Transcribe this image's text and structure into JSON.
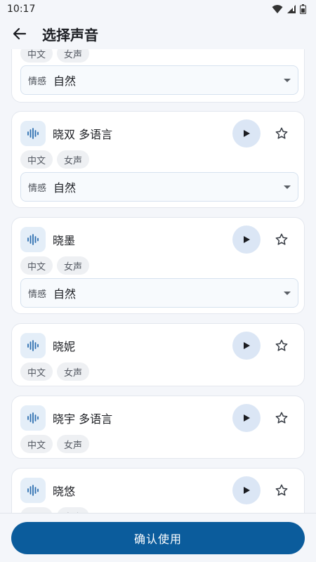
{
  "status_bar": {
    "time": "10:17",
    "icons": [
      "wifi-icon",
      "signal-icon",
      "battery-icon"
    ]
  },
  "header": {
    "title": "选择声音",
    "back_icon": "arrow-left-icon"
  },
  "voices": [
    {
      "name": "",
      "tags": [
        "中文",
        "女声"
      ],
      "emotion": {
        "label": "情感",
        "value": "自然"
      }
    },
    {
      "name": "晓双 多语言",
      "tags": [
        "中文",
        "女声"
      ],
      "emotion": {
        "label": "情感",
        "value": "自然"
      }
    },
    {
      "name": "晓墨",
      "tags": [
        "中文",
        "女声"
      ],
      "emotion": {
        "label": "情感",
        "value": "自然"
      }
    },
    {
      "name": "晓妮",
      "tags": [
        "中文",
        "女声"
      ]
    },
    {
      "name": "晓宇 多语言",
      "tags": [
        "中文",
        "女声"
      ]
    },
    {
      "name": "晓悠",
      "tags": [
        "中文",
        "女声"
      ]
    }
  ],
  "footer": {
    "confirm_label": "确认使用"
  },
  "colors": {
    "primary": "#0b5c9c",
    "play_bg": "#dbe6f5",
    "icon_tile": "#e4eef8",
    "background": "#f4f6fa"
  }
}
